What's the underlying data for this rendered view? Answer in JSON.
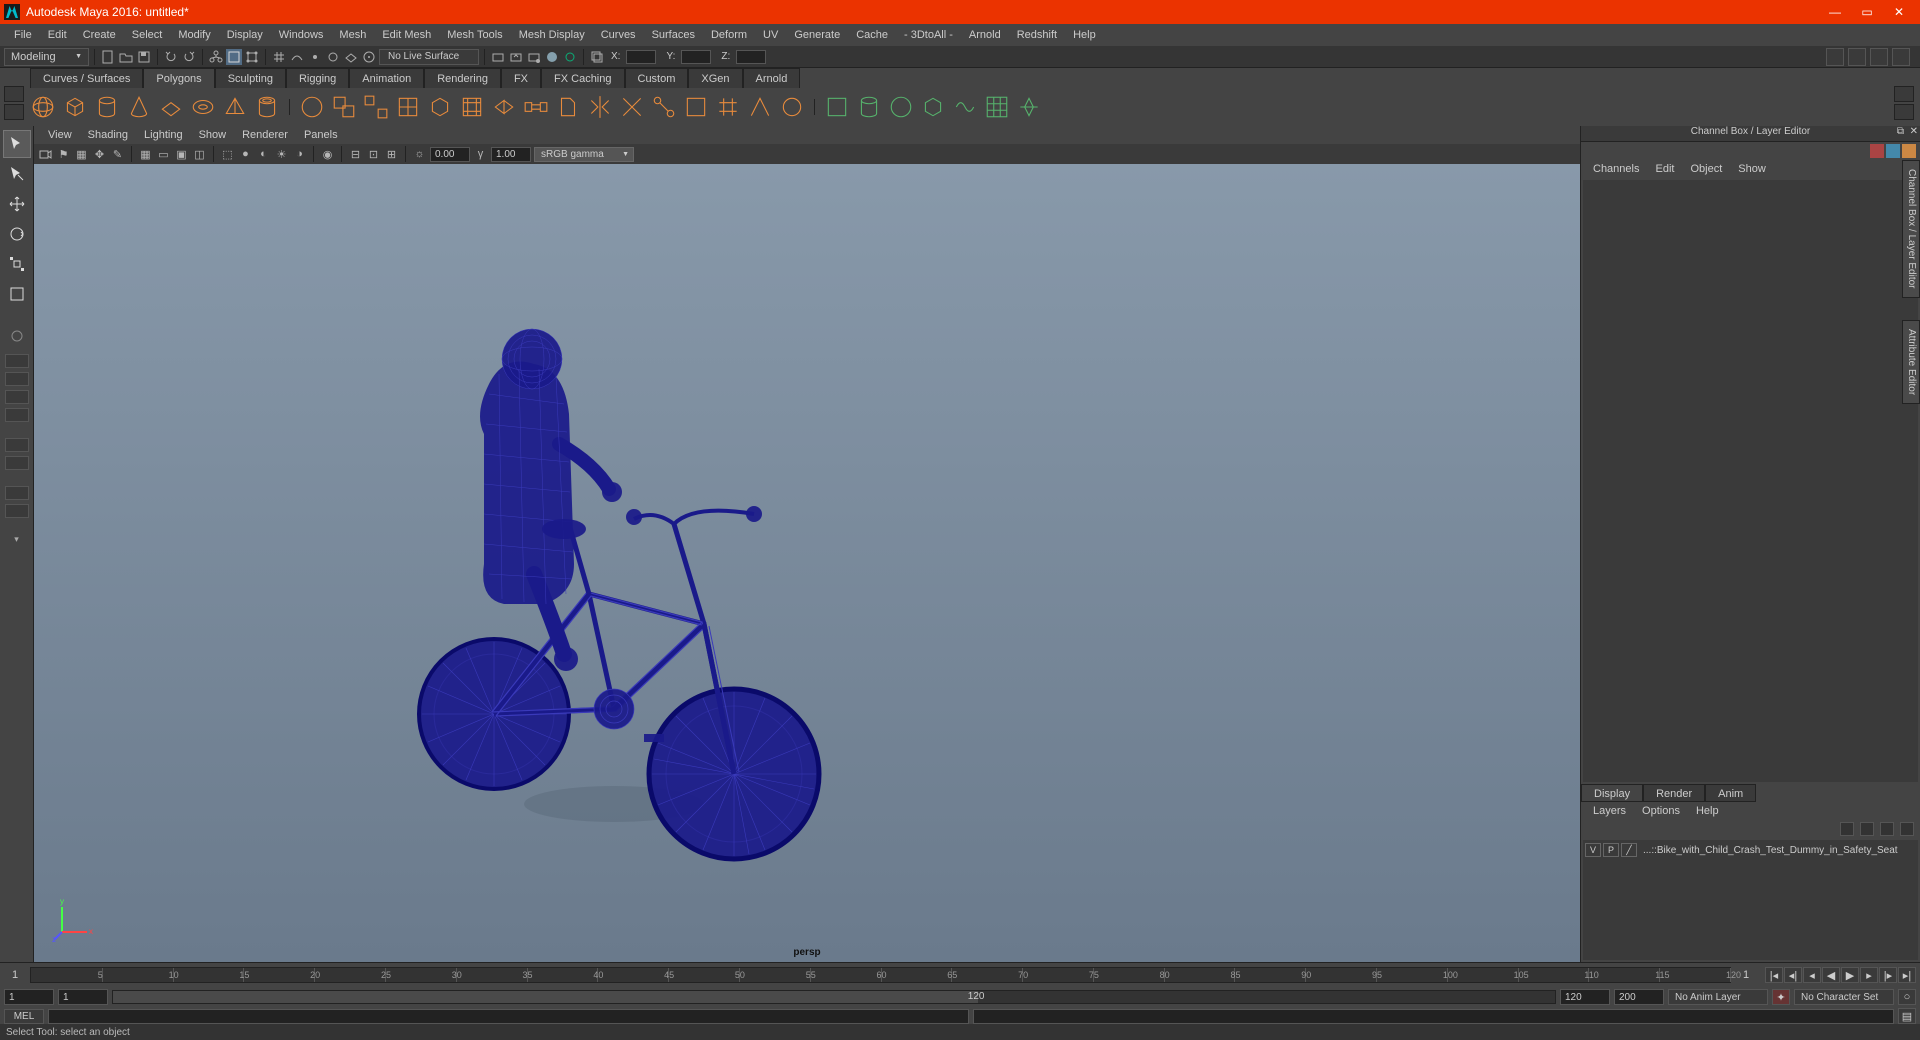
{
  "titlebar": {
    "title": "Autodesk Maya 2016: untitled*"
  },
  "menubar": [
    "File",
    "Edit",
    "Create",
    "Select",
    "Modify",
    "Display",
    "Windows",
    "Mesh",
    "Edit Mesh",
    "Mesh Tools",
    "Mesh Display",
    "Curves",
    "Surfaces",
    "Deform",
    "UV",
    "Generate",
    "Cache",
    "- 3DtoAll -",
    "Arnold",
    "Redshift",
    "Help"
  ],
  "workspace": "Modeling",
  "statusline": {
    "livesurface": "No Live Surface",
    "x": "X:",
    "y": "Y:",
    "z": "Z:"
  },
  "shelftabs": [
    "Curves / Surfaces",
    "Polygons",
    "Sculpting",
    "Rigging",
    "Animation",
    "Rendering",
    "FX",
    "FX Caching",
    "Custom",
    "XGen",
    "Arnold"
  ],
  "activeShelf": "Polygons",
  "panel": {
    "menus": [
      "View",
      "Shading",
      "Lighting",
      "Show",
      "Renderer",
      "Panels"
    ],
    "exposure": "0.00",
    "gamma": "1.00",
    "colorspace": "sRGB gamma",
    "camera": "persp"
  },
  "channelbox": {
    "title": "Channel Box / Layer Editor",
    "menus": [
      "Channels",
      "Edit",
      "Object",
      "Show"
    ]
  },
  "layers": {
    "tabs": [
      "Display",
      "Render",
      "Anim"
    ],
    "active": "Display",
    "menus": [
      "Layers",
      "Options",
      "Help"
    ],
    "row": {
      "v": "V",
      "p": "P",
      "name": "...::Bike_with_Child_Crash_Test_Dummy_in_Safety_Seat"
    }
  },
  "sidetabs": {
    "channel": "Channel Box / Layer Editor",
    "attr": "Attribute Editor"
  },
  "timeline": {
    "current": "1",
    "start": "1",
    "end": "120",
    "rngstart": "1",
    "rngend": "120",
    "total": "200",
    "animlayer": "No Anim Layer",
    "charset": "No Character Set",
    "ticks": [
      5,
      10,
      15,
      20,
      25,
      30,
      35,
      40,
      45,
      50,
      55,
      60,
      65,
      70,
      75,
      80,
      85,
      90,
      95,
      100,
      105,
      110,
      115,
      120
    ]
  },
  "cmdline": {
    "label": "MEL"
  },
  "status": "Select Tool: select an object"
}
